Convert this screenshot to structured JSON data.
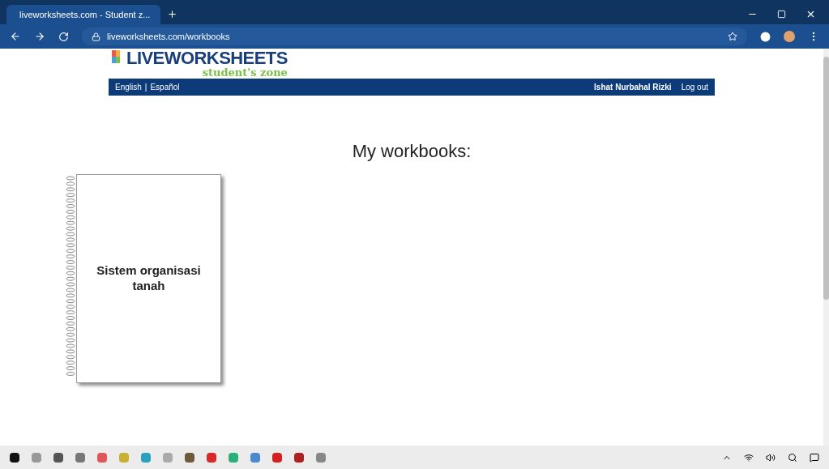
{
  "browser": {
    "tab_title": "liveworksheets.com - Student z...",
    "address": "liveworksheets.com/workbooks"
  },
  "site": {
    "logo_text": "LIVEWORKSHEETS",
    "logo_subtitle": "student's zone"
  },
  "nav": {
    "languages": [
      "English",
      "Español"
    ],
    "separator": "|",
    "user_name": "Ishat Nurbahal Rizki",
    "logout": "Log out"
  },
  "heading": "My workbooks:",
  "workbooks": [
    {
      "title": "Sistem organisasi tanah"
    }
  ]
}
